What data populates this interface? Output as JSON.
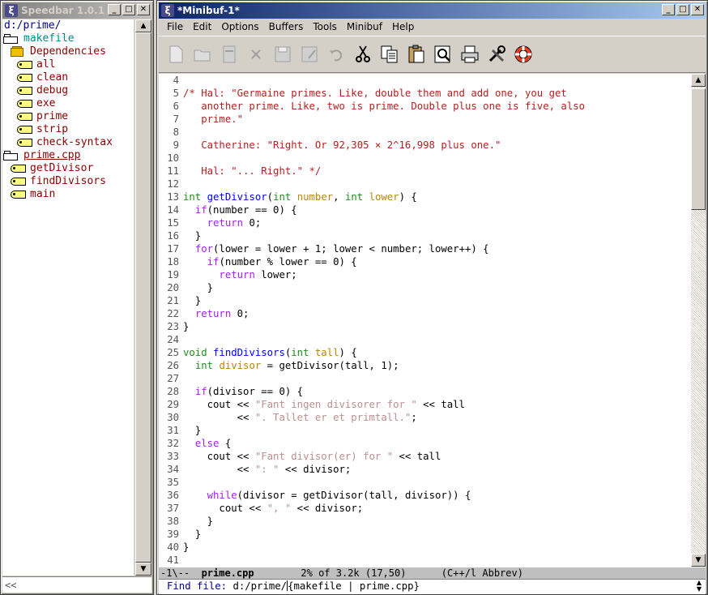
{
  "speedbar": {
    "title": "Speedbar 1.0.1",
    "path": "d:/prime/",
    "makefile": "makefile",
    "dependencies": "Dependencies",
    "targets": [
      "all",
      "clean",
      "debug",
      "exe",
      "prime",
      "strip",
      "check-syntax"
    ],
    "file": "prime.cpp",
    "functions": [
      "getDivisor",
      "findDivisors",
      "main"
    ],
    "echo": "<<"
  },
  "main": {
    "title": "*Minibuf-1*",
    "menu": [
      "File",
      "Edit",
      "Options",
      "Buffers",
      "Tools",
      "Minibuf",
      "Help"
    ],
    "toolbar": [
      "new-file",
      "open-folder",
      "dired",
      "close",
      "save",
      "save-as",
      "undo",
      "cut",
      "copy",
      "paste",
      "search",
      "print",
      "customize",
      "help"
    ],
    "modeline": {
      "prefix": "-1\\--  ",
      "buffer": "prime.cpp",
      "rest": "        2% of 3.2k (17,50)      (C++/l Abbrev)"
    },
    "minibuffer": {
      "prompt": "Find file: ",
      "value_before": "d:/prime/",
      "value_after": "{makefile | prime.cpp}"
    }
  },
  "code_lines": [
    {
      "n": "4",
      "parts": []
    },
    {
      "n": "5",
      "parts": [
        [
          "cm",
          "/* Hal: \"Germaine primes. Like, double them and add one, you get"
        ]
      ]
    },
    {
      "n": "6",
      "parts": [
        [
          "cm",
          "   another prime. Like, two is prime. Double plus one is five, also"
        ]
      ]
    },
    {
      "n": "7",
      "parts": [
        [
          "cm",
          "   prime.\""
        ]
      ]
    },
    {
      "n": "8",
      "parts": []
    },
    {
      "n": "9",
      "parts": [
        [
          "cm",
          "   Catherine: \"Right. Or 92,305 × 2^16,998 plus one.\""
        ]
      ]
    },
    {
      "n": "10",
      "parts": []
    },
    {
      "n": "11",
      "parts": [
        [
          "cm",
          "   Hal: \"... Right.\" */"
        ]
      ]
    },
    {
      "n": "12",
      "parts": []
    },
    {
      "n": "13",
      "parts": [
        [
          "ty",
          "int"
        ],
        [
          "",
          " "
        ],
        [
          "fn",
          "getDivisor"
        ],
        [
          "",
          "("
        ],
        [
          "ty",
          "int"
        ],
        [
          "",
          " "
        ],
        [
          "vr",
          "number"
        ],
        [
          "",
          ", "
        ],
        [
          "ty",
          "int"
        ],
        [
          "",
          " "
        ],
        [
          "vr",
          "lower"
        ],
        [
          "",
          ") {"
        ]
      ]
    },
    {
      "n": "14",
      "parts": [
        [
          "",
          "  "
        ],
        [
          "k",
          "if"
        ],
        [
          "",
          "(number == 0) {"
        ]
      ]
    },
    {
      "n": "15",
      "parts": [
        [
          "",
          "    "
        ],
        [
          "k",
          "return"
        ],
        [
          "",
          " 0;"
        ]
      ]
    },
    {
      "n": "16",
      "parts": [
        [
          "",
          "  }"
        ]
      ]
    },
    {
      "n": "17",
      "parts": [
        [
          "",
          "  "
        ],
        [
          "k",
          "for"
        ],
        [
          "",
          "(lower = lower + 1; lower < number; lower++) {"
        ]
      ]
    },
    {
      "n": "18",
      "parts": [
        [
          "",
          "    "
        ],
        [
          "k",
          "if"
        ],
        [
          "",
          "(number % lower == 0) {"
        ]
      ]
    },
    {
      "n": "19",
      "parts": [
        [
          "",
          "      "
        ],
        [
          "k",
          "return"
        ],
        [
          "",
          " lower;"
        ]
      ]
    },
    {
      "n": "20",
      "parts": [
        [
          "",
          "    }"
        ]
      ]
    },
    {
      "n": "21",
      "parts": [
        [
          "",
          "  }"
        ]
      ]
    },
    {
      "n": "22",
      "parts": [
        [
          "",
          "  "
        ],
        [
          "k",
          "return"
        ],
        [
          "",
          " 0;"
        ]
      ]
    },
    {
      "n": "23",
      "parts": [
        [
          "",
          "}"
        ]
      ]
    },
    {
      "n": "24",
      "parts": []
    },
    {
      "n": "25",
      "parts": [
        [
          "ty",
          "void"
        ],
        [
          "",
          " "
        ],
        [
          "fn",
          "findDivisors"
        ],
        [
          "",
          "("
        ],
        [
          "ty",
          "int"
        ],
        [
          "",
          " "
        ],
        [
          "vr",
          "tall"
        ],
        [
          "",
          ") {"
        ]
      ]
    },
    {
      "n": "26",
      "parts": [
        [
          "",
          "  "
        ],
        [
          "ty",
          "int"
        ],
        [
          "",
          " "
        ],
        [
          "vr",
          "divisor"
        ],
        [
          "",
          " = getDivisor(tall, 1);"
        ]
      ]
    },
    {
      "n": "27",
      "parts": []
    },
    {
      "n": "28",
      "parts": [
        [
          "",
          "  "
        ],
        [
          "k",
          "if"
        ],
        [
          "",
          "(divisor == 0) {"
        ]
      ]
    },
    {
      "n": "29",
      "parts": [
        [
          "",
          "    cout << "
        ],
        [
          "st",
          "\"Fant ingen divisorer for \""
        ],
        [
          "",
          " << tall"
        ]
      ]
    },
    {
      "n": "30",
      "parts": [
        [
          "",
          "         << "
        ],
        [
          "st",
          "\". Tallet er et primtall.\""
        ],
        [
          "",
          ";"
        ]
      ]
    },
    {
      "n": "31",
      "parts": [
        [
          "",
          "  }"
        ]
      ]
    },
    {
      "n": "32",
      "parts": [
        [
          "",
          "  "
        ],
        [
          "k",
          "else"
        ],
        [
          "",
          " {"
        ]
      ]
    },
    {
      "n": "33",
      "parts": [
        [
          "",
          "    cout << "
        ],
        [
          "st",
          "\"Fant divisor(er) for \""
        ],
        [
          "",
          " << tall"
        ]
      ]
    },
    {
      "n": "34",
      "parts": [
        [
          "",
          "         << "
        ],
        [
          "st",
          "\": \""
        ],
        [
          "",
          " << divisor;"
        ]
      ]
    },
    {
      "n": "35",
      "parts": []
    },
    {
      "n": "36",
      "parts": [
        [
          "",
          "    "
        ],
        [
          "k",
          "while"
        ],
        [
          "",
          "(divisor = getDivisor(tall, divisor)) {"
        ]
      ]
    },
    {
      "n": "37",
      "parts": [
        [
          "",
          "      cout << "
        ],
        [
          "st",
          "\", \""
        ],
        [
          "",
          " << divisor;"
        ]
      ]
    },
    {
      "n": "38",
      "parts": [
        [
          "",
          "    }"
        ]
      ]
    },
    {
      "n": "39",
      "parts": [
        [
          "",
          "  }"
        ]
      ]
    },
    {
      "n": "40",
      "parts": [
        [
          "",
          "}"
        ]
      ]
    },
    {
      "n": "41",
      "parts": []
    }
  ]
}
